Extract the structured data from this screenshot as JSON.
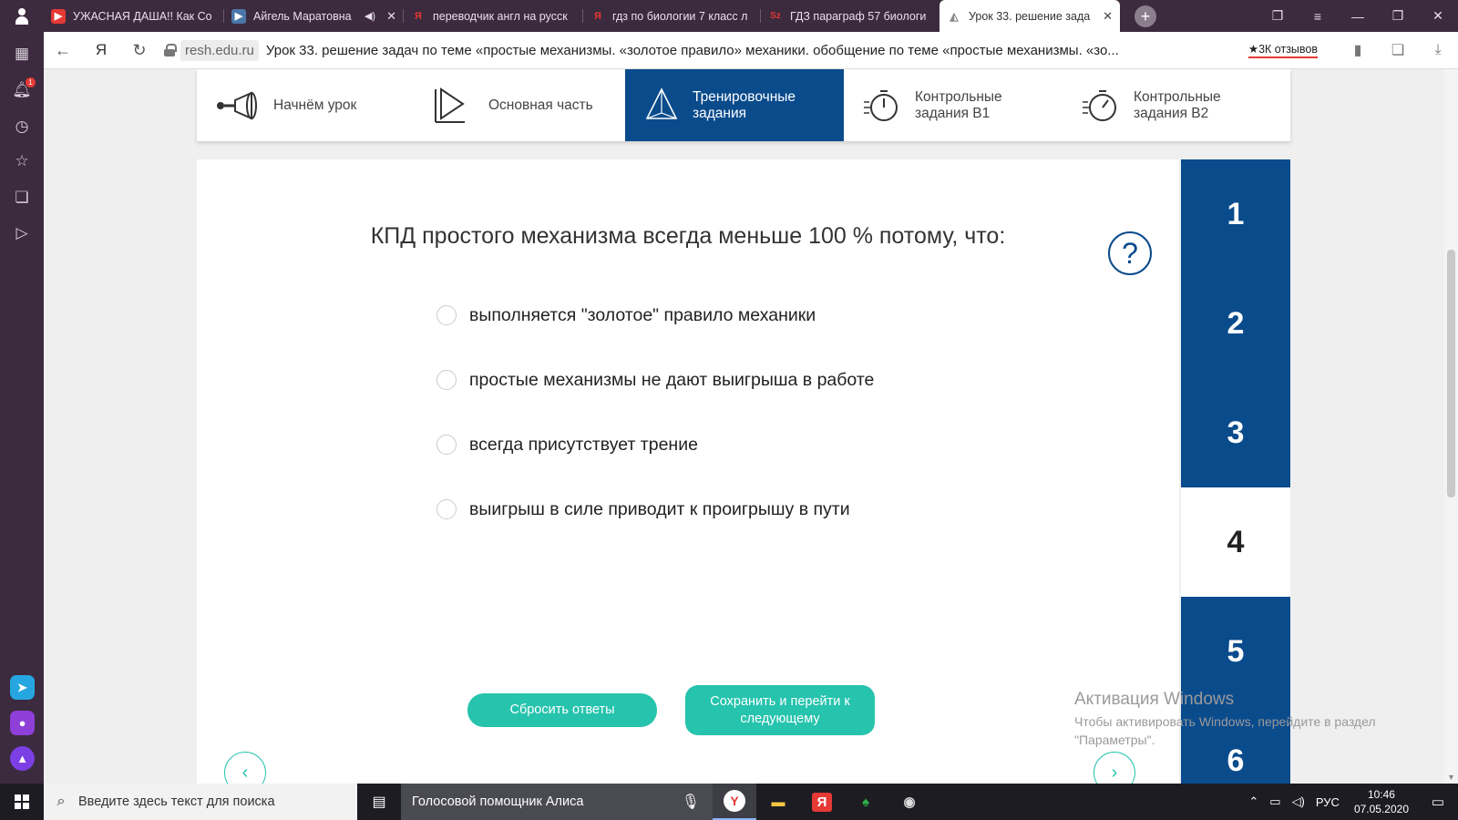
{
  "tabs": [
    {
      "favicon": "youtube-icon",
      "color": "#e53935",
      "label": "УЖАСНАЯ ДАША!! Как Со",
      "speaker": false
    },
    {
      "favicon": "vk-video-icon",
      "color": "#4a76a8",
      "label": "Айгель Маратовна",
      "speaker": true
    },
    {
      "favicon": "yandex-icon",
      "color": "#e53935",
      "label": "переводчик англ на русск",
      "speaker": false
    },
    {
      "favicon": "yandex-icon",
      "color": "#e53935",
      "label": "гдз по биологии 7 класс л",
      "speaker": false
    },
    {
      "favicon": "gdz-icon",
      "color": "#e53935",
      "label": "ГДЗ параграф 57 биологи",
      "speaker": false
    },
    {
      "favicon": "resh-icon",
      "color": "#aaaaaa",
      "label": "Урок 33. решение зада",
      "speaker": false,
      "active": true
    }
  ],
  "address": {
    "domain": "resh.edu.ru",
    "title": "Урок 33. решение задач по теме «простые механизмы. «золотое правило» механики. обобщение по теме «простые механизмы. «зо...",
    "reviews": "★3К отзывов"
  },
  "sidebar": {
    "notification_count": "1"
  },
  "steps": [
    {
      "label": "Начнём урок",
      "icon": "megaphone-icon",
      "active": false
    },
    {
      "label": "Основная часть",
      "icon": "play-icon",
      "active": false
    },
    {
      "label": "Тренировочные задания",
      "icon": "pyramid-icon",
      "active": true
    },
    {
      "label": "Контрольные задания В1",
      "icon": "stopwatch-icon",
      "active": false
    },
    {
      "label": "Контрольные задания В2",
      "icon": "stopwatch-icon",
      "active": false
    }
  ],
  "task": {
    "question": "КПД простого механизма всегда меньше 100 % потому, что:",
    "options": [
      "выполняется \"золотое\" правило механики",
      "простые механизмы не дают выигрыша в работе",
      "всегда присутствует трение",
      "выигрыш в силе приводит к проигрышу в пути"
    ],
    "reset_label": "Сбросить ответы",
    "save_label": "Сохранить и перейти к следующему",
    "help_glyph": "?"
  },
  "task_numbers": [
    "1",
    "2",
    "3",
    "4",
    "5",
    "6"
  ],
  "current_task": "4",
  "watermark": {
    "title": "Активация Windows",
    "line1": "Чтобы активировать Windows, перейдите в раздел",
    "line2": "\"Параметры\"."
  },
  "taskbar": {
    "search_placeholder": "Введите здесь текст для поиска",
    "alice_label": "Голосовой помощник Алиса",
    "language": "РУС",
    "time": "10:46",
    "date": "07.05.2020"
  },
  "colors": {
    "primary": "#0a4b8c",
    "accent": "#26c3ad",
    "browser_chrome": "#3c2a3e"
  }
}
